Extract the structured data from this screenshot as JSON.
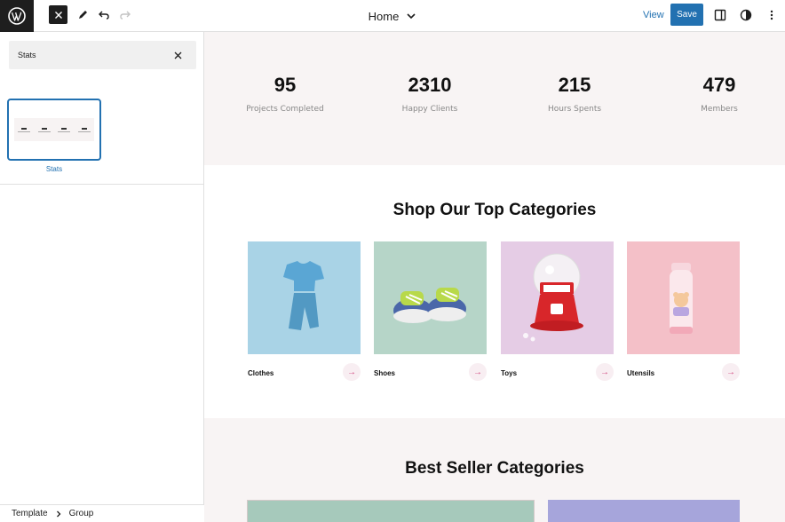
{
  "toolbar": {
    "document_title": "Home",
    "view_label": "View",
    "save_label": "Save"
  },
  "sidebar": {
    "search_value": "Stats",
    "pattern_label": "Stats"
  },
  "breadcrumb": {
    "items": [
      "Template",
      "Group"
    ]
  },
  "stats": [
    {
      "number": "95",
      "label": "Projects Completed"
    },
    {
      "number": "2310",
      "label": "Happy Clients"
    },
    {
      "number": "215",
      "label": "Hours Spents"
    },
    {
      "number": "479",
      "label": "Members"
    }
  ],
  "categories": {
    "heading": "Shop Our Top Categories",
    "items": [
      {
        "name": "Clothes",
        "arrow": "→",
        "bg": "#a9d3e6"
      },
      {
        "name": "Shoes",
        "arrow": "→",
        "bg": "#b6d5c8"
      },
      {
        "name": "Toys",
        "arrow": "→",
        "bg": "#e5cce5"
      },
      {
        "name": "Utensils",
        "arrow": "→",
        "bg": "#f4c0c8"
      }
    ]
  },
  "best_seller": {
    "heading": "Best Seller Categories"
  },
  "colors": {
    "accent": "#2271b1",
    "dark": "#1e1e1e",
    "section_bg": "#f8f4f4"
  }
}
